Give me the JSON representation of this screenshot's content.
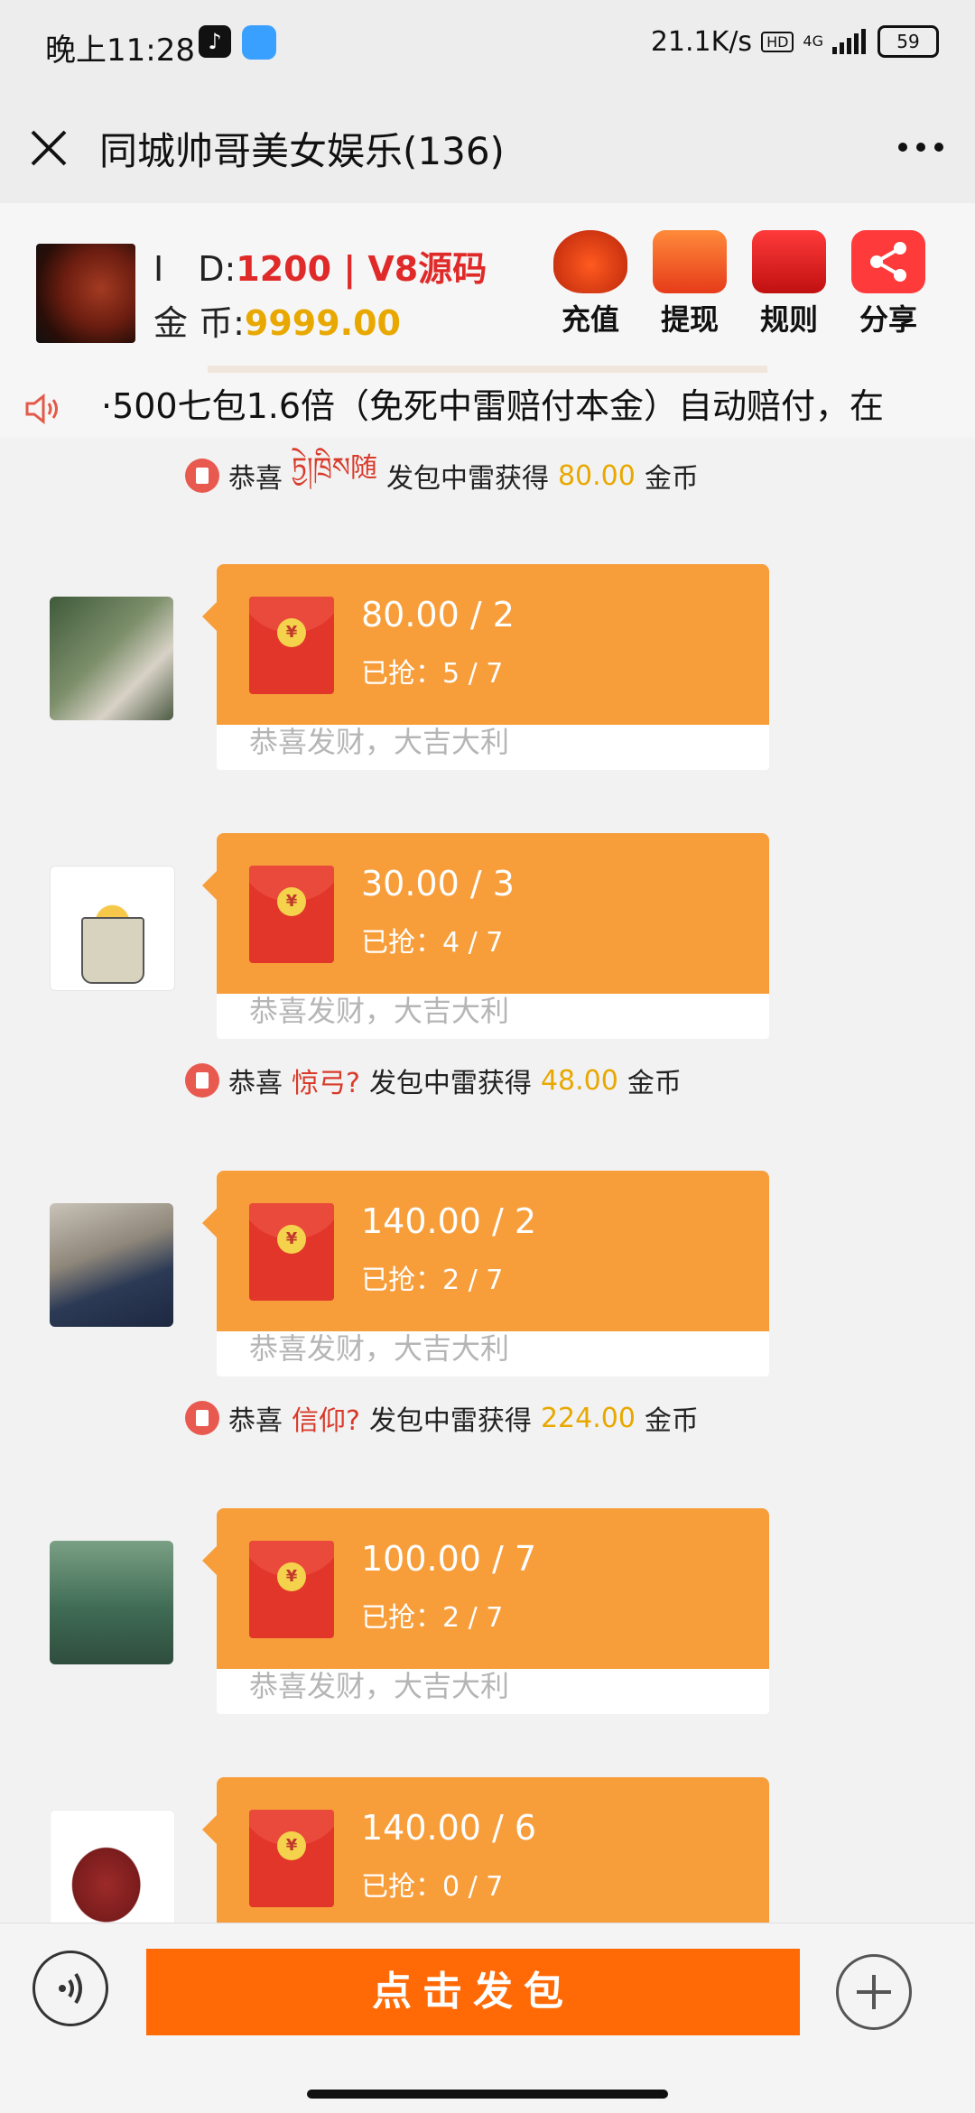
{
  "status_bar": {
    "time": "晚上11:28",
    "net_speed": "21.1K/s",
    "hd": "HD",
    "network": "4G",
    "battery": "59"
  },
  "header": {
    "title": "同城帅哥美女娱乐(136)"
  },
  "user": {
    "id_label": "I　D:",
    "id_value": "1200 | V8源码",
    "coin_label": "金 币:",
    "coin_value": "9999.00"
  },
  "actions": [
    {
      "label": "充值",
      "icon": "recharge-icon"
    },
    {
      "label": "提现",
      "icon": "withdraw-icon"
    },
    {
      "label": "规则",
      "icon": "rules-icon"
    },
    {
      "label": "分享",
      "icon": "share-icon"
    }
  ],
  "ticker": {
    "text": "·500七包1.6倍（免死中雷赔付本金）自动赔付，在"
  },
  "notices": [
    {
      "prefix": "恭喜",
      "name": "ཏྱེ།ཁྲིས随",
      "middle": "发包中雷获得",
      "amount": "80.00",
      "suffix": "金币"
    },
    {
      "prefix": "恭喜",
      "name": "惊弓?",
      "middle": "发包中雷获得",
      "amount": "48.00",
      "suffix": "金币"
    },
    {
      "prefix": "恭喜",
      "name": "信仰?",
      "middle": "发包中雷获得",
      "amount": "224.00",
      "suffix": "金币"
    }
  ],
  "messages": [
    {
      "amount": "80.00 / 2",
      "grabbed": "已抢：5 / 7",
      "greeting": "恭喜发财，大吉大利"
    },
    {
      "amount": "30.00 / 3",
      "grabbed": "已抢：4 / 7",
      "greeting": "恭喜发财，大吉大利"
    },
    {
      "amount": "140.00 / 2",
      "grabbed": "已抢：2 / 7",
      "greeting": "恭喜发财，大吉大利"
    },
    {
      "amount": "100.00 / 7",
      "grabbed": "已抢：2 / 7",
      "greeting": "恭喜发财，大吉大利"
    },
    {
      "amount": "140.00 / 6",
      "grabbed": "已抢：0 / 7",
      "greeting": ""
    }
  ],
  "bottom": {
    "send_label": "点击发包"
  }
}
